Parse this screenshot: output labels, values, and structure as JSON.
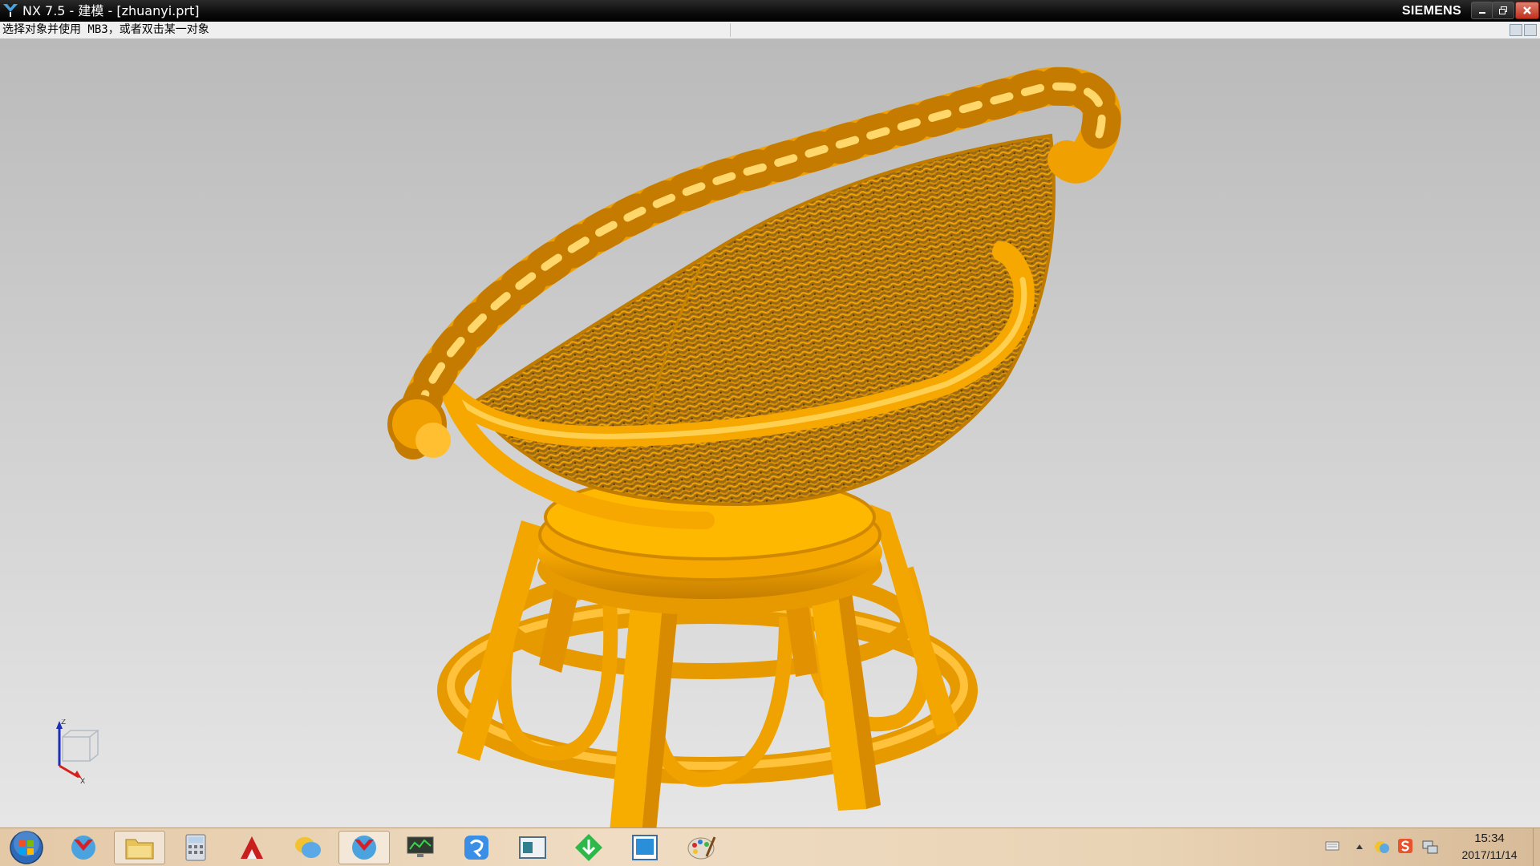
{
  "window": {
    "title": "NX 7.5 - 建模 - [zhuanyi.prt]",
    "brand": "SIEMENS",
    "controls": [
      "minimize",
      "restore",
      "close"
    ]
  },
  "cue_line": {
    "text": "选择对象并使用 MB3，或者双击某一对象"
  },
  "viewport": {
    "model_color": "#f6a800",
    "background_top": "#bababa",
    "background_bottom": "#e6e6e6",
    "triad_labels": {
      "z": "Z",
      "x": "X"
    }
  },
  "taskbar": {
    "start_icon": "windows-orb-icon",
    "items": [
      {
        "name": "nx-app-icon",
        "active": false
      },
      {
        "name": "folder-icon",
        "active": true
      },
      {
        "name": "calculator-icon",
        "active": false
      },
      {
        "name": "autocad-icon",
        "active": false
      },
      {
        "name": "chat-bubbles-icon",
        "active": false
      },
      {
        "name": "nx-app-icon",
        "active": true
      },
      {
        "name": "monitor-icon",
        "active": false
      },
      {
        "name": "blue-app-icon",
        "active": false
      },
      {
        "name": "window-app-icon",
        "active": false
      },
      {
        "name": "download-arrow-icon",
        "active": false
      },
      {
        "name": "blue-window-icon",
        "active": false
      },
      {
        "name": "paint-palette-icon",
        "active": false
      }
    ],
    "tray": {
      "icons": [
        "keyboard-icon",
        "show-hidden-icons-arrow",
        "network-app-icon",
        "sogou-input-icon",
        "network-status-icon"
      ],
      "time": "15:34",
      "date": "2017/11/14"
    }
  }
}
